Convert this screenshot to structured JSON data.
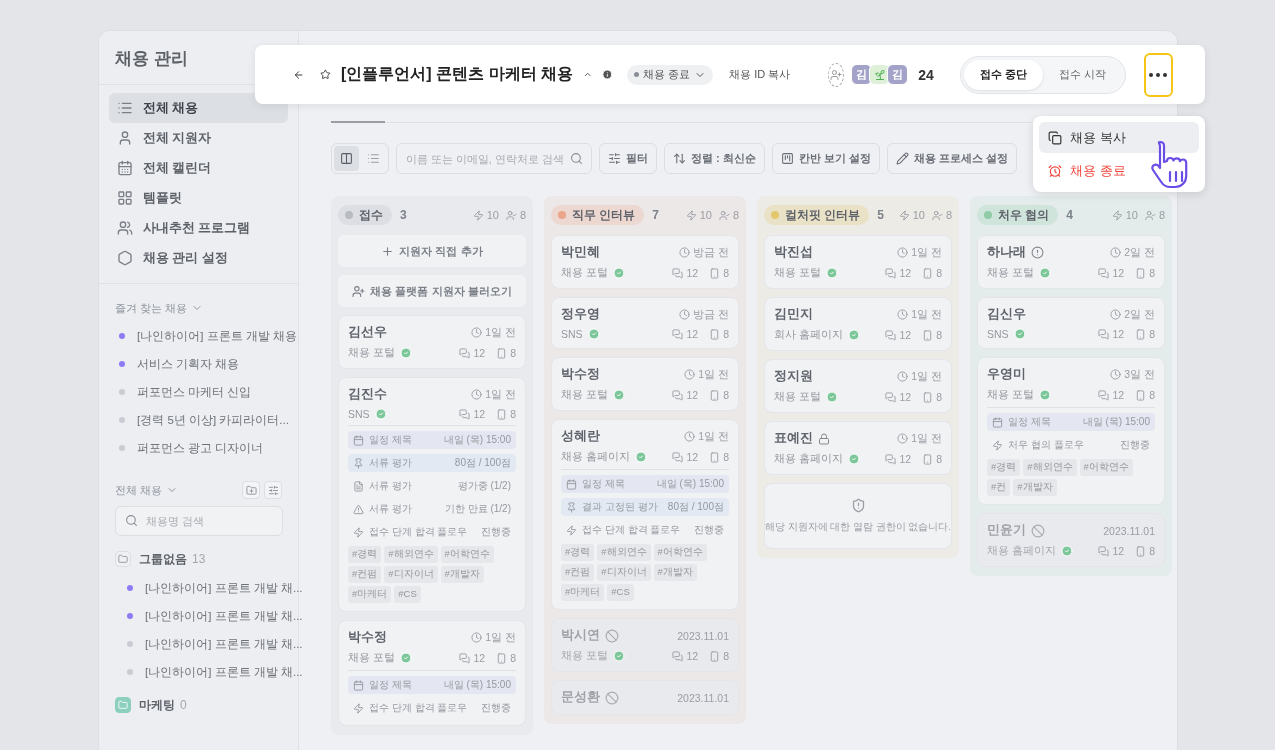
{
  "sidebar": {
    "title": "채용 관리",
    "nav": [
      {
        "label": "전체 채용",
        "selected": true
      },
      {
        "label": "전체 지원자",
        "selected": false
      },
      {
        "label": "전체 캘린더",
        "selected": false
      },
      {
        "label": "템플릿",
        "selected": false
      },
      {
        "label": "사내추천 프로그램",
        "selected": false
      },
      {
        "label": "채용 관리 설정",
        "selected": false
      }
    ],
    "favorites": {
      "title": "즐겨 찾는 채용",
      "items": [
        {
          "label": "[나인하이어] 프론트 개발 채용",
          "color": "#8b7cf6"
        },
        {
          "label": "서비스 기획자 채용",
          "color": "#8b7cf6"
        },
        {
          "label": "퍼포먼스 마케터 신입",
          "color": "#c9ccd2"
        },
        {
          "label": "[경력 5년 이상] 카피라이터...",
          "color": "#c9ccd2"
        },
        {
          "label": "퍼포먼스 광고 디자이너",
          "color": "#c9ccd2"
        }
      ]
    },
    "all": {
      "title": "전체 채용",
      "search_placeholder": "채용명 검색",
      "groups": [
        {
          "name": "그룹없음",
          "count": "13",
          "kind": "plain",
          "items": [
            {
              "label": "[나인하이어] 프론트 개발 채...",
              "color": "#8b7cf6"
            },
            {
              "label": "[나인하이어] 프론트 개발 채...",
              "color": "#8b7cf6"
            },
            {
              "label": "[나인하이어] 프론트 개발 채...",
              "color": "#c9ccd2"
            },
            {
              "label": "[나인하이어] 프론트 개발 채...",
              "color": "#c9ccd2"
            }
          ]
        },
        {
          "name": "마케팅",
          "count": "0",
          "kind": "colored"
        }
      ]
    }
  },
  "toolbar": {
    "views": [
      {
        "kind": "board",
        "selected": true
      },
      {
        "kind": "list",
        "selected": false
      }
    ],
    "search_placeholder": "이름 또는 이메일, 연락처로 검색",
    "buttons": [
      {
        "label": "필터"
      },
      {
        "label": "정렬 : 최신순"
      },
      {
        "label": "칸반 보기 설정"
      },
      {
        "label": "채용 프로세스 설정"
      }
    ]
  },
  "columns": [
    {
      "name": "접수",
      "color": "#b8bbc2",
      "count": "3",
      "flows": "10",
      "people": "8",
      "actions": [
        {
          "label": "지원자 직접 추가",
          "kind": "add"
        },
        {
          "label": "채용 플랫폼 지원자 불러오기",
          "kind": "import"
        }
      ],
      "cards": [
        {
          "kind": "applicant",
          "name": "김선우",
          "time": "1일 전",
          "source": "채용 포털",
          "comments": "12",
          "files": "8",
          "disabled": false,
          "locked": false,
          "warning": false
        },
        {
          "kind": "applicant",
          "name": "김진수",
          "time": "1일 전",
          "source": "SNS",
          "comments": "12",
          "files": "8",
          "disabled": false,
          "locked": false,
          "warning": false,
          "details": [
            {
              "kind": "schedule",
              "label": "일정 제목",
              "value": "내일 (목) 15:00"
            },
            {
              "kind": "pinned",
              "label": "서류 평가",
              "value": "80점 / 100점"
            },
            {
              "kind": "doc",
              "label": "서류 평가",
              "value": "평가중 (1/2)"
            },
            {
              "kind": "warning",
              "label": "서류 평가",
              "value": "기한 만료 (1/2)"
            },
            {
              "kind": "flow",
              "label": "접수 단계 합격 플로우",
              "value": "진행중"
            }
          ],
          "tags": [
            "#경력",
            "#해외연수",
            "#어학연수",
            "#컨펌",
            "#디자이너",
            "#개발자",
            "#마케터",
            "#CS"
          ]
        },
        {
          "kind": "applicant",
          "name": "박수정",
          "time": "1일 전",
          "source": "채용 포털",
          "comments": "12",
          "files": "8",
          "disabled": false,
          "locked": false,
          "warning": false,
          "details": [
            {
              "kind": "schedule",
              "label": "일정 제목",
              "value": "내일 (목) 15:00"
            },
            {
              "kind": "flow",
              "label": "접수 단계 합격 플로우",
              "value": "진행중"
            }
          ]
        }
      ]
    },
    {
      "name": "직무 인터뷰",
      "color": "#eba58b",
      "count": "7",
      "flows": "10",
      "people": "8",
      "cards": [
        {
          "kind": "applicant",
          "name": "박민혜",
          "time": "방금 전",
          "source": "채용 포털",
          "comments": "12",
          "files": "8",
          "disabled": false,
          "locked": false,
          "warning": false
        },
        {
          "kind": "applicant",
          "name": "정우영",
          "time": "방금 전",
          "source": "SNS",
          "comments": "12",
          "files": "8",
          "disabled": false,
          "locked": false,
          "warning": false
        },
        {
          "kind": "applicant",
          "name": "박수정",
          "time": "1일 전",
          "source": "채용 포털",
          "comments": "12",
          "files": "8",
          "disabled": false,
          "locked": false,
          "warning": false
        },
        {
          "kind": "applicant",
          "name": "성혜란",
          "time": "1일 전",
          "source": "채용 홈페이지",
          "comments": "12",
          "files": "8",
          "disabled": false,
          "locked": false,
          "warning": false,
          "details": [
            {
              "kind": "schedule",
              "label": "일정 제목",
              "value": "내일 (목) 15:00"
            },
            {
              "kind": "pinned",
              "label": "결과 고정된 평가",
              "value": "80점 / 100점"
            },
            {
              "kind": "flow",
              "label": "접수 단계 합격 플로우",
              "value": "진행중"
            }
          ],
          "tags": [
            "#경력",
            "#해외연수",
            "#어학연수",
            "#컨펌",
            "#디자이너",
            "#개발자",
            "#마케터",
            "#CS"
          ]
        },
        {
          "kind": "applicant",
          "name": "박시연",
          "time": "2023.11.01",
          "source": "채용 포털",
          "comments": "12",
          "files": "8",
          "disabled": true,
          "locked": false,
          "warning": false
        },
        {
          "kind": "applicant",
          "name": "문성환",
          "time": "2023.11.01",
          "disabled": true,
          "locked": false,
          "warning": false
        }
      ]
    },
    {
      "name": "컬처핏 인터뷰",
      "color": "#e2c76c",
      "count": "5",
      "flows": "10",
      "people": "8",
      "cards": [
        {
          "kind": "applicant",
          "name": "박진섭",
          "time": "1일 전",
          "source": "채용 포털",
          "comments": "12",
          "files": "8",
          "disabled": false,
          "locked": false,
          "warning": false
        },
        {
          "kind": "applicant",
          "name": "김민지",
          "time": "1일 전",
          "source": "회사 홈페이지",
          "comments": "12",
          "files": "8",
          "disabled": false,
          "locked": false,
          "warning": false
        },
        {
          "kind": "applicant",
          "name": "정지원",
          "time": "1일 전",
          "source": "채용 포털",
          "comments": "12",
          "files": "8",
          "disabled": false,
          "locked": false,
          "warning": false
        },
        {
          "kind": "applicant",
          "name": "표예진",
          "time": "1일 전",
          "source": "채용 홈페이지",
          "comments": "12",
          "files": "8",
          "disabled": false,
          "locked": true,
          "warning": false
        },
        {
          "kind": "restricted",
          "message": "해당 지원자에 대한 열람 권한이 없습니다."
        }
      ]
    },
    {
      "name": "처우 협의",
      "color": "#8fcba6",
      "count": "4",
      "flows": "10",
      "people": "8",
      "cards": [
        {
          "kind": "applicant",
          "name": "하나래",
          "time": "2일 전",
          "source": "채용 포털",
          "comments": "12",
          "files": "8",
          "disabled": false,
          "locked": false,
          "warning": true
        },
        {
          "kind": "applicant",
          "name": "김신우",
          "time": "2일 전",
          "source": "SNS",
          "comments": "12",
          "files": "8",
          "disabled": false,
          "locked": false,
          "warning": false
        },
        {
          "kind": "applicant",
          "name": "우영미",
          "time": "3일 전",
          "source": "채용 포털",
          "comments": "12",
          "files": "8",
          "disabled": false,
          "locked": false,
          "warning": false,
          "details": [
            {
              "kind": "schedule",
              "label": "일정 제목",
              "value": "내일 (목) 15:00"
            },
            {
              "kind": "flow",
              "label": "처우 협의 플로우",
              "value": "진행중"
            }
          ],
          "tags": [
            "#경력",
            "#해외연수",
            "#어학연수",
            "#컨",
            "#개발자"
          ]
        },
        {
          "kind": "applicant",
          "name": "민윤기",
          "time": "2023.11.01",
          "source": "채용 홈페이지",
          "comments": "12",
          "files": "8",
          "disabled": true,
          "locked": false,
          "warning": false
        }
      ]
    }
  ],
  "header": {
    "title": "[인플루언서] 콘텐츠 마케터 채용",
    "status": "채용 종료",
    "copy_id": "채용 ID 복사",
    "avatars": [
      {
        "kind": "letter",
        "label": "김"
      },
      {
        "kind": "sprout"
      },
      {
        "kind": "letter",
        "label": "김"
      }
    ],
    "member_count": "24",
    "toggle": [
      {
        "label": "접수 중단",
        "selected": true
      },
      {
        "label": "접수 시작",
        "selected": false
      }
    ],
    "more_focused": true
  },
  "menu": [
    {
      "label": "채용 복사",
      "kind": "copy",
      "highlighted": true
    },
    {
      "label": "채용 종료",
      "kind": "danger",
      "highlighted": false
    }
  ]
}
